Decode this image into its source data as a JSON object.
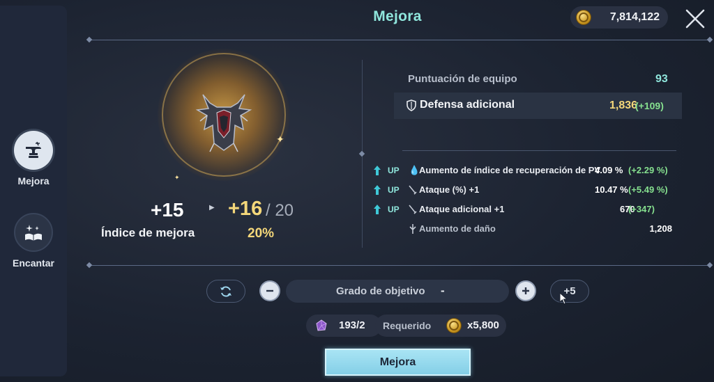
{
  "header": {
    "title": "Mejora",
    "gold": "7,814,122"
  },
  "sidebar": {
    "items": [
      {
        "label": "Mejora",
        "icon": "anvil-icon",
        "active": true
      },
      {
        "label": "Encantar",
        "icon": "spellbook-icon",
        "active": false
      }
    ]
  },
  "item": {
    "current_level": "+15",
    "next_level": "+16",
    "max_level": "/ 20",
    "rate_label": "Índice de mejora",
    "rate_value": "20%"
  },
  "stats": {
    "score_label": "Puntuación de equipo",
    "score_value": "93",
    "defense_label": "Defensa adicional",
    "defense_value": "1,836",
    "defense_gain": "(+109)",
    "rows": [
      {
        "up": "UP",
        "label": "Aumento de índice de recuperación de PV",
        "value": "4.09 %",
        "gain": "(+2.29 %)"
      },
      {
        "up": "UP",
        "label": "Ataque (%) +1",
        "value": "10.47 %",
        "gain": "(+5.49 %)"
      },
      {
        "up": "UP",
        "label": "Ataque adicional +1",
        "value": "670",
        "gain": "(+347)"
      },
      {
        "label": "Aumento de daño",
        "value": "1,208"
      }
    ]
  },
  "controls": {
    "grade_label": "Grado de objetivo",
    "grade_value": "-",
    "plus5_label": "+5"
  },
  "cost": {
    "material_count": "193/2",
    "required_label": "Requerido",
    "required_gold": "x5,800"
  },
  "action": {
    "label": "Mejora"
  },
  "colors": {
    "accent": "#8fe6dc",
    "gold": "#f4d77a",
    "gain": "#86e08f",
    "button": "#a9e4f4"
  }
}
